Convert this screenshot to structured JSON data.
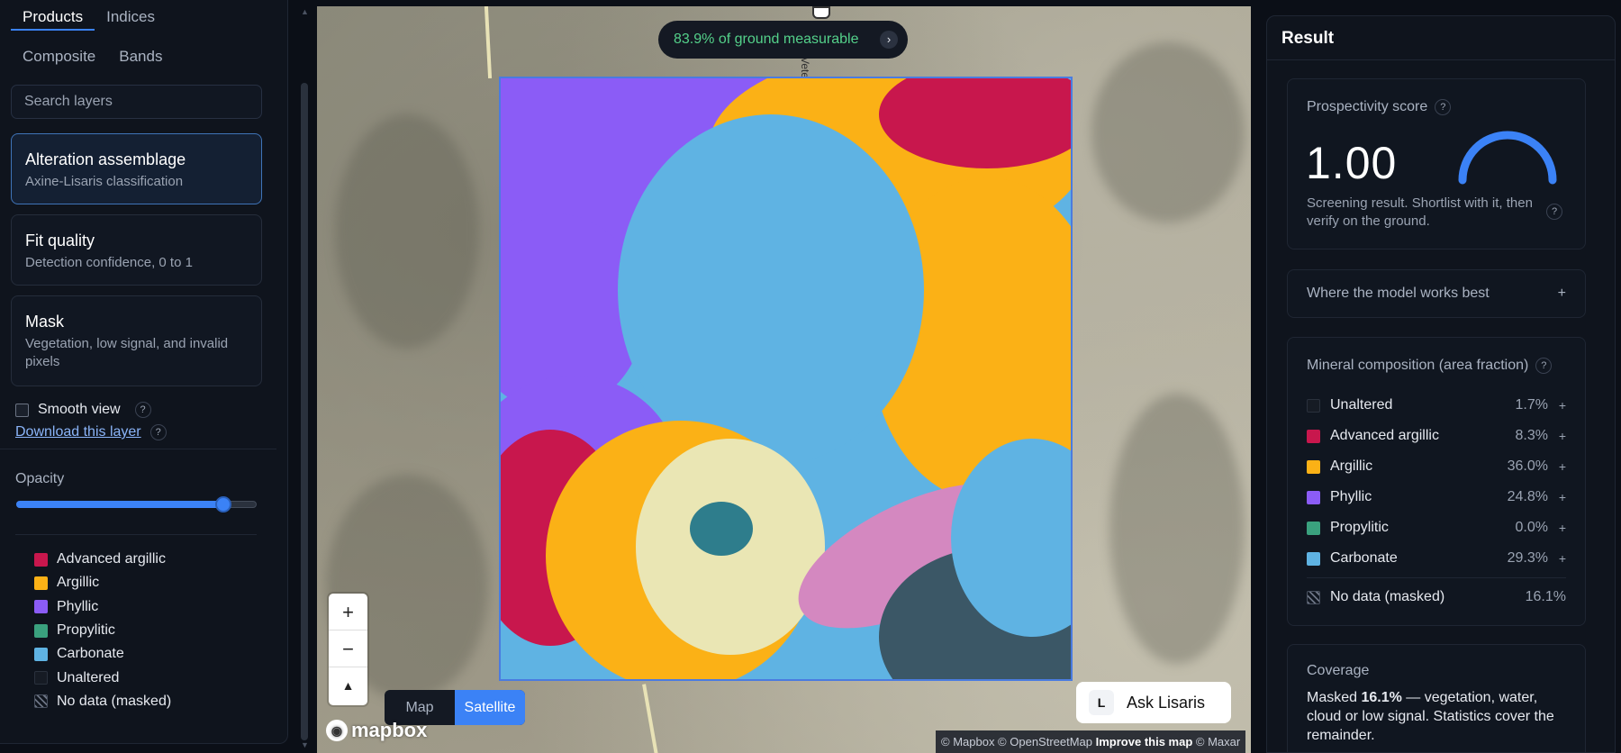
{
  "left": {
    "tabs_top": [
      {
        "label": "Products",
        "active": true
      },
      {
        "label": "Indices",
        "active": false
      }
    ],
    "tabs_bottom": [
      {
        "label": "Composite"
      },
      {
        "label": "Bands"
      }
    ],
    "search_placeholder": "Search layers",
    "cards": [
      {
        "title": "Alteration assemblage",
        "sub": "Axine-Lisaris classification",
        "active": true
      },
      {
        "title": "Fit quality",
        "sub": "Detection confidence, 0 to 1",
        "active": false
      },
      {
        "title": "Mask",
        "sub": "Vegetation, low signal, and invalid pixels",
        "active": false
      }
    ],
    "smooth_view": "Smooth view",
    "download": "Download this layer",
    "opacity_label": "Opacity",
    "opacity_value": 0.86,
    "legend": [
      {
        "label": "Advanced argillic",
        "color": "#c8174d"
      },
      {
        "label": "Argillic",
        "color": "#fbb116"
      },
      {
        "label": "Phyllic",
        "color": "#8b5cf6"
      },
      {
        "label": "Propylitic",
        "color": "#3aa17e"
      },
      {
        "label": "Carbonate",
        "color": "#5fb3e3"
      },
      {
        "label": "Unaltered",
        "color": "empty"
      },
      {
        "label": "No data (masked)",
        "color": "hatch"
      }
    ]
  },
  "map": {
    "coverage_pill": "83.9% of ground measurable",
    "zoom_in": "+",
    "zoom_out": "−",
    "compass": "▲",
    "toggle": [
      {
        "label": "Map",
        "active": false
      },
      {
        "label": "Satellite",
        "active": true
      }
    ],
    "mapbox": "mapbox",
    "attrib_prefix": "© Mapbox © OpenStreetMap ",
    "attrib_improve": "Improve this map",
    "attrib_suffix": " © Maxar",
    "ask_key": "L",
    "ask_label": "Ask Lisaris",
    "road_label": "Vete"
  },
  "right": {
    "title": "Result",
    "score_label": "Prospectivity score",
    "score_value": "1.00",
    "score_fraction": 1.0,
    "score_note": "Screening result. Shortlist with it, then verify on the ground.",
    "where_label": "Where the model works best",
    "where_plus": "+",
    "comp_title": "Mineral composition (area fraction)",
    "comp": [
      {
        "name": "Unaltered",
        "pct": "1.7%",
        "color": "empty"
      },
      {
        "name": "Advanced argillic",
        "pct": "8.3%",
        "color": "#c8174d"
      },
      {
        "name": "Argillic",
        "pct": "36.0%",
        "color": "#fbb116"
      },
      {
        "name": "Phyllic",
        "pct": "24.8%",
        "color": "#8b5cf6"
      },
      {
        "name": "Propylitic",
        "pct": "0.0%",
        "color": "#3aa17e"
      },
      {
        "name": "Carbonate",
        "pct": "29.3%",
        "color": "#5fb3e3"
      }
    ],
    "nodata_label": "No data (masked)",
    "nodata_pct": "16.1%",
    "coverage_title": "Coverage",
    "coverage_pre": "Masked ",
    "coverage_bold": "16.1%",
    "coverage_post": " — vegetation, water, cloud or low signal. Statistics cover the remainder."
  },
  "colors": {
    "accent": "#3b82f6",
    "pill_text": "#54d18a"
  }
}
